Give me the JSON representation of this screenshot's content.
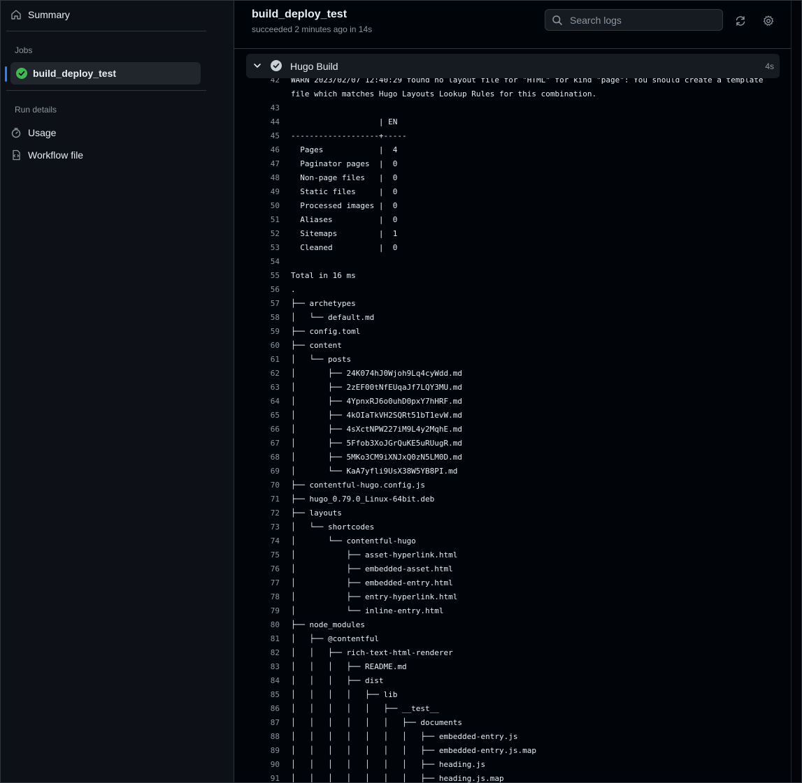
{
  "sidebar": {
    "summary_label": "Summary",
    "jobs_heading": "Jobs",
    "job_label": "build_deploy_test",
    "run_details_heading": "Run details",
    "usage_label": "Usage",
    "workflow_label": "Workflow file"
  },
  "header": {
    "title": "build_deploy_test",
    "subtitle": "succeeded 2 minutes ago in 14s",
    "search_placeholder": "Search logs"
  },
  "step": {
    "title": "Hugo Build",
    "duration": "4s"
  },
  "log": [
    {
      "n": "42",
      "t": "WARN 2023/02/07 12:40:29 found no layout file for \"HTML\" for kind \"page\": You should create a template"
    },
    {
      "n": "",
      "t": "file which matches Hugo Layouts Lookup Rules for this combination."
    },
    {
      "n": "43",
      "t": ""
    },
    {
      "n": "44",
      "t": "                   | EN"
    },
    {
      "n": "45",
      "t": "-------------------+-----"
    },
    {
      "n": "46",
      "t": "  Pages            |  4"
    },
    {
      "n": "47",
      "t": "  Paginator pages  |  0"
    },
    {
      "n": "48",
      "t": "  Non-page files   |  0"
    },
    {
      "n": "49",
      "t": "  Static files     |  0"
    },
    {
      "n": "50",
      "t": "  Processed images |  0"
    },
    {
      "n": "51",
      "t": "  Aliases          |  0"
    },
    {
      "n": "52",
      "t": "  Sitemaps         |  1"
    },
    {
      "n": "53",
      "t": "  Cleaned          |  0"
    },
    {
      "n": "54",
      "t": ""
    },
    {
      "n": "55",
      "t": "Total in 16 ms"
    },
    {
      "n": "56",
      "t": "."
    },
    {
      "n": "57",
      "t": "├── archetypes"
    },
    {
      "n": "58",
      "t": "│   └── default.md"
    },
    {
      "n": "59",
      "t": "├── config.toml"
    },
    {
      "n": "60",
      "t": "├── content"
    },
    {
      "n": "61",
      "t": "│   └── posts"
    },
    {
      "n": "62",
      "t": "│       ├── 24K074hJ0Wjoh9Lq4cyWdd.md"
    },
    {
      "n": "63",
      "t": "│       ├── 2zEF00tNfEUqaJf7LQY3MU.md"
    },
    {
      "n": "64",
      "t": "│       ├── 4YpnxRJ6o0uhD0pxY7hHRF.md"
    },
    {
      "n": "65",
      "t": "│       ├── 4kOIaTkVH2SQRt51bT1evW.md"
    },
    {
      "n": "66",
      "t": "│       ├── 4sXctNPW227iM9L4y2MqhE.md"
    },
    {
      "n": "67",
      "t": "│       ├── 5Ffob3XoJGrQuKE5uRUugR.md"
    },
    {
      "n": "68",
      "t": "│       ├── 5MKo3CM9iXNJxQ0zN5LM0D.md"
    },
    {
      "n": "69",
      "t": "│       └── KaA7yfli9UsX38W5YB8PI.md"
    },
    {
      "n": "70",
      "t": "├── contentful-hugo.config.js"
    },
    {
      "n": "71",
      "t": "├── hugo_0.79.0_Linux-64bit.deb"
    },
    {
      "n": "72",
      "t": "├── layouts"
    },
    {
      "n": "73",
      "t": "│   └── shortcodes"
    },
    {
      "n": "74",
      "t": "│       └── contentful-hugo"
    },
    {
      "n": "75",
      "t": "│           ├── asset-hyperlink.html"
    },
    {
      "n": "76",
      "t": "│           ├── embedded-asset.html"
    },
    {
      "n": "77",
      "t": "│           ├── embedded-entry.html"
    },
    {
      "n": "78",
      "t": "│           ├── entry-hyperlink.html"
    },
    {
      "n": "79",
      "t": "│           └── inline-entry.html"
    },
    {
      "n": "80",
      "t": "├── node_modules"
    },
    {
      "n": "81",
      "t": "│   ├── @contentful"
    },
    {
      "n": "82",
      "t": "│   │   ├── rich-text-html-renderer"
    },
    {
      "n": "83",
      "t": "│   │   │   ├── README.md"
    },
    {
      "n": "84",
      "t": "│   │   │   ├── dist"
    },
    {
      "n": "85",
      "t": "│   │   │   │   ├── lib"
    },
    {
      "n": "86",
      "t": "│   │   │   │   │   ├── __test__"
    },
    {
      "n": "87",
      "t": "│   │   │   │   │   │   ├── documents"
    },
    {
      "n": "88",
      "t": "│   │   │   │   │   │   │   ├── embedded-entry.js"
    },
    {
      "n": "89",
      "t": "│   │   │   │   │   │   │   ├── embedded-entry.js.map"
    },
    {
      "n": "90",
      "t": "│   │   │   │   │   │   │   ├── heading.js"
    },
    {
      "n": "91",
      "t": "│   │   │   │   │   │   │   ├── heading.js.map"
    }
  ]
}
